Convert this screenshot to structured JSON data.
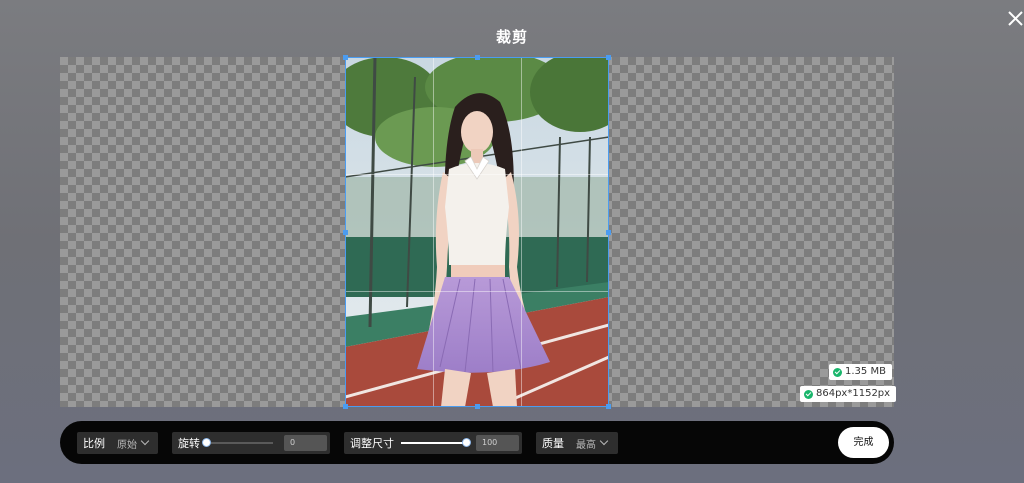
{
  "dialog": {
    "title": "裁剪",
    "close_icon": "close-icon"
  },
  "image_info": {
    "file_size": "1.35 MB",
    "dimensions": "864px*1152px",
    "status_color": "#1ab66c"
  },
  "toolbar": {
    "ratio": {
      "label": "比例",
      "value": "原始"
    },
    "rotate": {
      "label": "旋转",
      "value": "0",
      "level": 0
    },
    "resize": {
      "label": "调整尺寸",
      "value": "100",
      "level": 100
    },
    "quality": {
      "label": "质量",
      "value": "最高"
    },
    "done_label": "完成"
  },
  "colors": {
    "crop_frame": "#4b9cf0",
    "toolbar_bg": "#060606"
  }
}
